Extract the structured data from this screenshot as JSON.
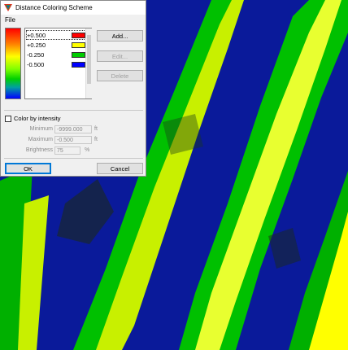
{
  "dialog": {
    "title": "Distance Coloring Scheme",
    "menu": [
      "File"
    ],
    "gradient_colors": [
      "#ff0000",
      "#ff8000",
      "#ffff00",
      "#80ff00",
      "#00d000",
      "#00a0a0",
      "#0000ff"
    ],
    "scheme_entries": [
      {
        "value": "+0.500",
        "color": "#ff0000"
      },
      {
        "value": "+0.250",
        "color": "#ffff00"
      },
      {
        "value": "-0.250",
        "color": "#00cc00"
      },
      {
        "value": "-0.500",
        "color": "#0000ff"
      }
    ],
    "buttons": {
      "add": "Add...",
      "edit": "Edit...",
      "delete": "Delete",
      "ok": "OK",
      "cancel": "Cancel"
    },
    "intensity": {
      "checkbox_label": "Color by intensity",
      "checked": false,
      "minimum_label": "Minimum",
      "minimum_value": "-9999.000",
      "minimum_unit": "ft",
      "maximum_label": "Maximum",
      "maximum_value": "-0.500",
      "maximum_unit": "ft",
      "brightness_label": "Brightness",
      "brightness_value": "75",
      "brightness_unit": "%"
    }
  },
  "viewport": {
    "background_color": "#0a1a9a",
    "band_colors": [
      "#0a1a9a",
      "#00c000",
      "#c8f000",
      "#ffff00",
      "#e8ff30",
      "#00b000"
    ]
  }
}
